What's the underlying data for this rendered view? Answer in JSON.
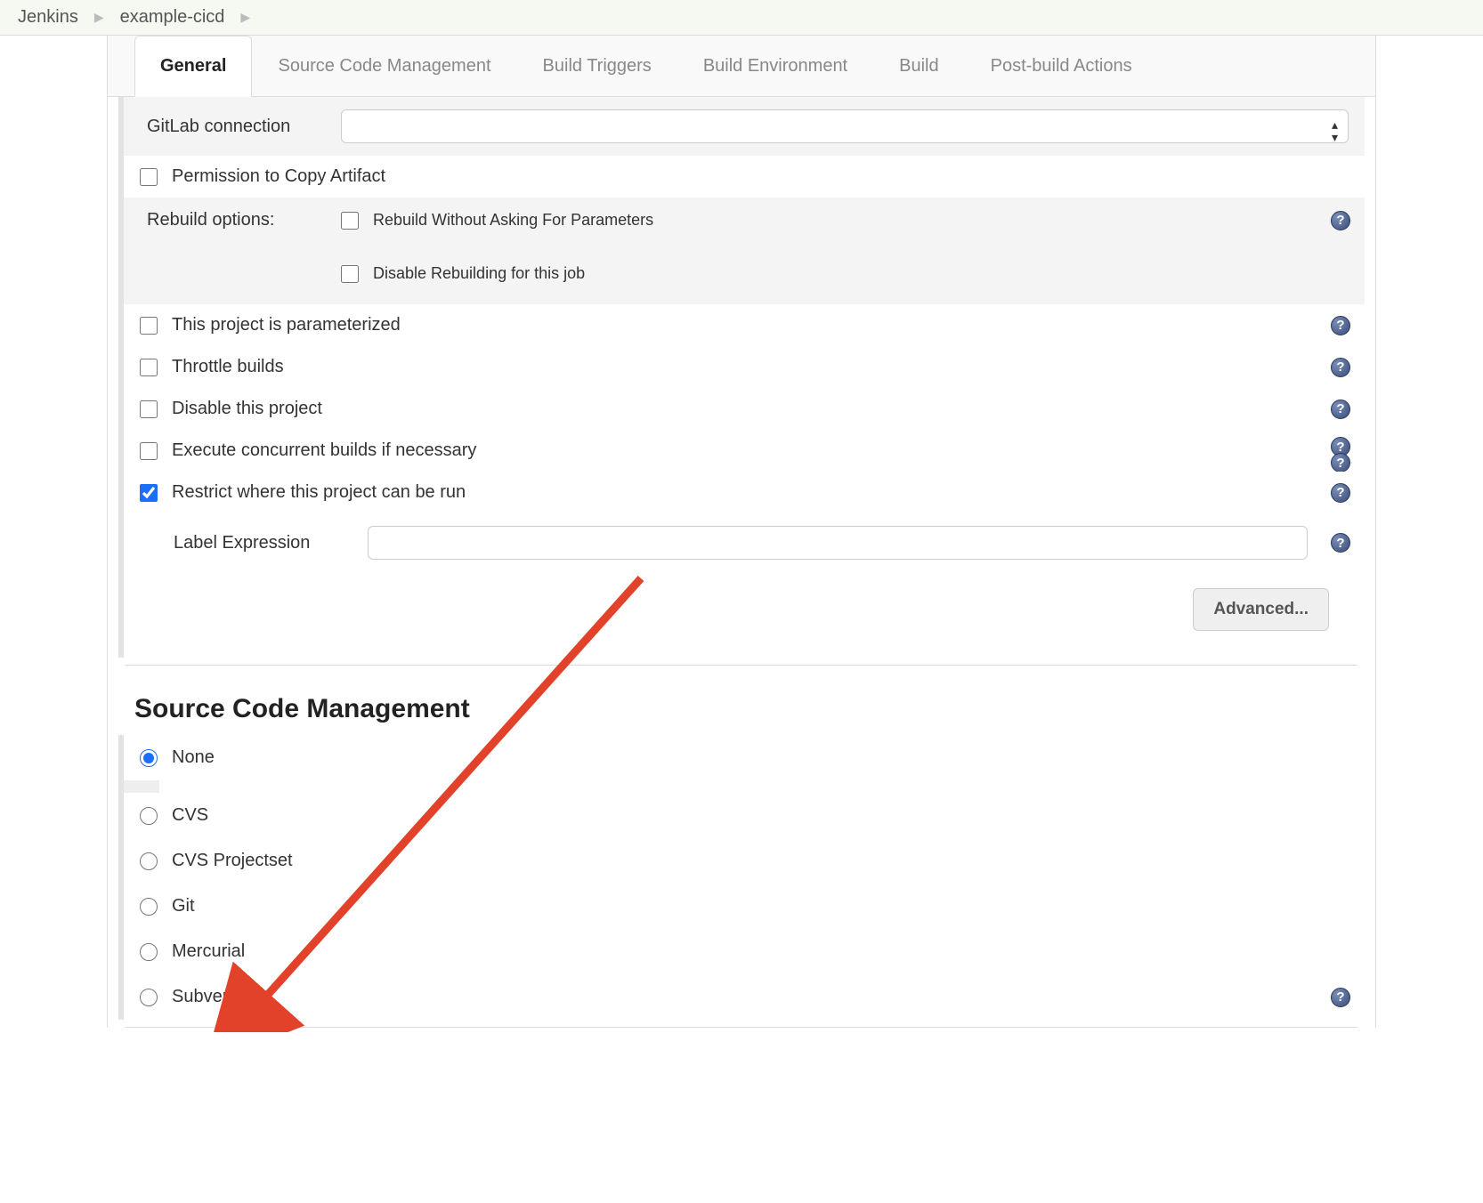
{
  "breadcrumb": {
    "root": "Jenkins",
    "project": "example-cicd"
  },
  "tabs": [
    {
      "label": "General",
      "active": true
    },
    {
      "label": "Source Code Management",
      "active": false
    },
    {
      "label": "Build Triggers",
      "active": false
    },
    {
      "label": "Build Environment",
      "active": false
    },
    {
      "label": "Build",
      "active": false
    },
    {
      "label": "Post-build Actions",
      "active": false
    }
  ],
  "general": {
    "gitlab_connection_label": "GitLab connection",
    "permission_copy_artifact": "Permission to Copy Artifact",
    "rebuild_options_label": "Rebuild options:",
    "rebuild_without_params": "Rebuild Without Asking For Parameters",
    "disable_rebuilding": "Disable Rebuilding for this job",
    "parameterized": "This project is parameterized",
    "throttle_builds": "Throttle builds",
    "disable_project": "Disable this project",
    "concurrent_builds": "Execute concurrent builds if necessary",
    "restrict_label": "Restrict where this project can be run",
    "restrict_checked": true,
    "label_expression_label": "Label Expression",
    "label_expression_value": "",
    "advanced_button": "Advanced..."
  },
  "scm": {
    "heading": "Source Code Management",
    "options": [
      {
        "label": "None",
        "checked": true
      },
      {
        "label": "CVS",
        "checked": false
      },
      {
        "label": "CVS Projectset",
        "checked": false
      },
      {
        "label": "Git",
        "checked": false
      },
      {
        "label": "Mercurial",
        "checked": false
      },
      {
        "label": "Subversion",
        "checked": false
      }
    ]
  }
}
